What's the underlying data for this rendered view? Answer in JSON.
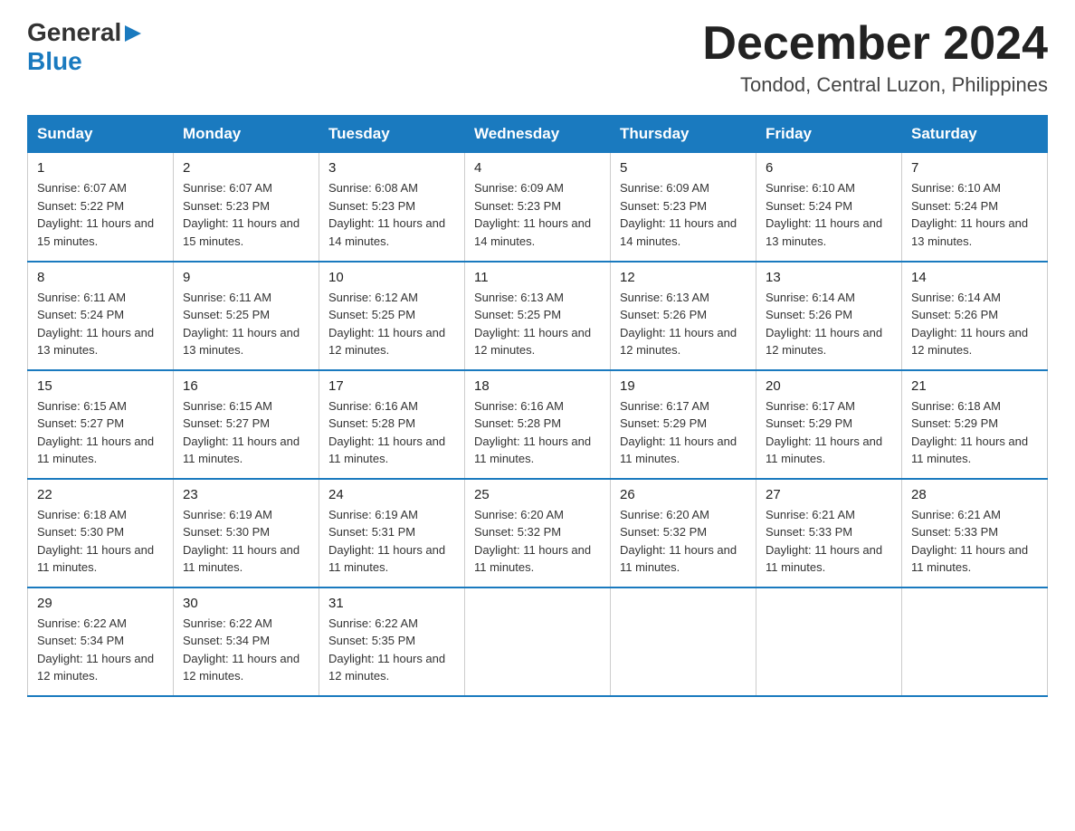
{
  "header": {
    "logo": {
      "general": "General",
      "triangle": "▶",
      "blue": "Blue"
    },
    "month_title": "December 2024",
    "location": "Tondod, Central Luzon, Philippines"
  },
  "weekdays": [
    "Sunday",
    "Monday",
    "Tuesday",
    "Wednesday",
    "Thursday",
    "Friday",
    "Saturday"
  ],
  "weeks": [
    [
      {
        "day": "1",
        "sunrise": "6:07 AM",
        "sunset": "5:22 PM",
        "daylight": "11 hours and 15 minutes."
      },
      {
        "day": "2",
        "sunrise": "6:07 AM",
        "sunset": "5:23 PM",
        "daylight": "11 hours and 15 minutes."
      },
      {
        "day": "3",
        "sunrise": "6:08 AM",
        "sunset": "5:23 PM",
        "daylight": "11 hours and 14 minutes."
      },
      {
        "day": "4",
        "sunrise": "6:09 AM",
        "sunset": "5:23 PM",
        "daylight": "11 hours and 14 minutes."
      },
      {
        "day": "5",
        "sunrise": "6:09 AM",
        "sunset": "5:23 PM",
        "daylight": "11 hours and 14 minutes."
      },
      {
        "day": "6",
        "sunrise": "6:10 AM",
        "sunset": "5:24 PM",
        "daylight": "11 hours and 13 minutes."
      },
      {
        "day": "7",
        "sunrise": "6:10 AM",
        "sunset": "5:24 PM",
        "daylight": "11 hours and 13 minutes."
      }
    ],
    [
      {
        "day": "8",
        "sunrise": "6:11 AM",
        "sunset": "5:24 PM",
        "daylight": "11 hours and 13 minutes."
      },
      {
        "day": "9",
        "sunrise": "6:11 AM",
        "sunset": "5:25 PM",
        "daylight": "11 hours and 13 minutes."
      },
      {
        "day": "10",
        "sunrise": "6:12 AM",
        "sunset": "5:25 PM",
        "daylight": "11 hours and 12 minutes."
      },
      {
        "day": "11",
        "sunrise": "6:13 AM",
        "sunset": "5:25 PM",
        "daylight": "11 hours and 12 minutes."
      },
      {
        "day": "12",
        "sunrise": "6:13 AM",
        "sunset": "5:26 PM",
        "daylight": "11 hours and 12 minutes."
      },
      {
        "day": "13",
        "sunrise": "6:14 AM",
        "sunset": "5:26 PM",
        "daylight": "11 hours and 12 minutes."
      },
      {
        "day": "14",
        "sunrise": "6:14 AM",
        "sunset": "5:26 PM",
        "daylight": "11 hours and 12 minutes."
      }
    ],
    [
      {
        "day": "15",
        "sunrise": "6:15 AM",
        "sunset": "5:27 PM",
        "daylight": "11 hours and 11 minutes."
      },
      {
        "day": "16",
        "sunrise": "6:15 AM",
        "sunset": "5:27 PM",
        "daylight": "11 hours and 11 minutes."
      },
      {
        "day": "17",
        "sunrise": "6:16 AM",
        "sunset": "5:28 PM",
        "daylight": "11 hours and 11 minutes."
      },
      {
        "day": "18",
        "sunrise": "6:16 AM",
        "sunset": "5:28 PM",
        "daylight": "11 hours and 11 minutes."
      },
      {
        "day": "19",
        "sunrise": "6:17 AM",
        "sunset": "5:29 PM",
        "daylight": "11 hours and 11 minutes."
      },
      {
        "day": "20",
        "sunrise": "6:17 AM",
        "sunset": "5:29 PM",
        "daylight": "11 hours and 11 minutes."
      },
      {
        "day": "21",
        "sunrise": "6:18 AM",
        "sunset": "5:29 PM",
        "daylight": "11 hours and 11 minutes."
      }
    ],
    [
      {
        "day": "22",
        "sunrise": "6:18 AM",
        "sunset": "5:30 PM",
        "daylight": "11 hours and 11 minutes."
      },
      {
        "day": "23",
        "sunrise": "6:19 AM",
        "sunset": "5:30 PM",
        "daylight": "11 hours and 11 minutes."
      },
      {
        "day": "24",
        "sunrise": "6:19 AM",
        "sunset": "5:31 PM",
        "daylight": "11 hours and 11 minutes."
      },
      {
        "day": "25",
        "sunrise": "6:20 AM",
        "sunset": "5:32 PM",
        "daylight": "11 hours and 11 minutes."
      },
      {
        "day": "26",
        "sunrise": "6:20 AM",
        "sunset": "5:32 PM",
        "daylight": "11 hours and 11 minutes."
      },
      {
        "day": "27",
        "sunrise": "6:21 AM",
        "sunset": "5:33 PM",
        "daylight": "11 hours and 11 minutes."
      },
      {
        "day": "28",
        "sunrise": "6:21 AM",
        "sunset": "5:33 PM",
        "daylight": "11 hours and 11 minutes."
      }
    ],
    [
      {
        "day": "29",
        "sunrise": "6:22 AM",
        "sunset": "5:34 PM",
        "daylight": "11 hours and 12 minutes."
      },
      {
        "day": "30",
        "sunrise": "6:22 AM",
        "sunset": "5:34 PM",
        "daylight": "11 hours and 12 minutes."
      },
      {
        "day": "31",
        "sunrise": "6:22 AM",
        "sunset": "5:35 PM",
        "daylight": "11 hours and 12 minutes."
      },
      null,
      null,
      null,
      null
    ]
  ]
}
